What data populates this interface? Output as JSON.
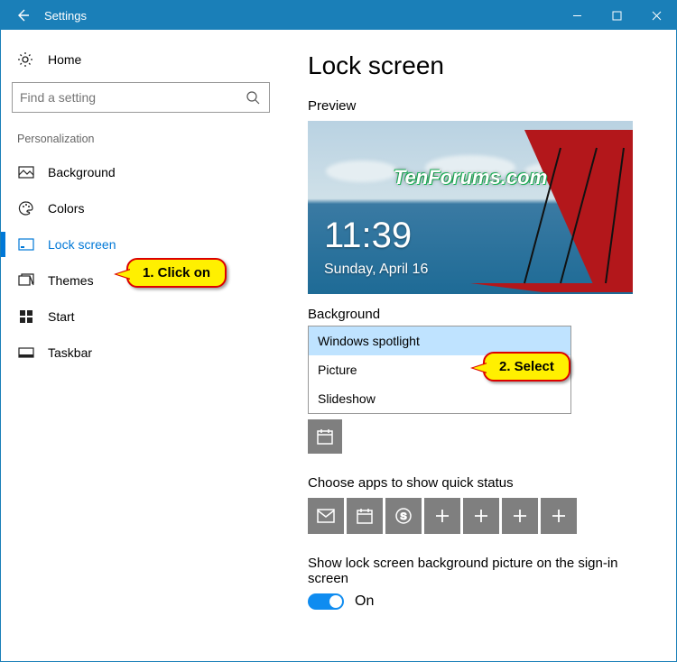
{
  "titlebar": {
    "title": "Settings"
  },
  "sidebar": {
    "home": "Home",
    "search_placeholder": "Find a setting",
    "section": "Personalization",
    "items": [
      {
        "label": "Background"
      },
      {
        "label": "Colors"
      },
      {
        "label": "Lock screen"
      },
      {
        "label": "Themes"
      },
      {
        "label": "Start"
      },
      {
        "label": "Taskbar"
      }
    ]
  },
  "main": {
    "page_title": "Lock screen",
    "preview_label": "Preview",
    "preview_time": "11:39",
    "preview_date": "Sunday, April 16",
    "watermark": "TenForums.com",
    "background_label": "Background",
    "dropdown": {
      "options": [
        "Windows spotlight",
        "Picture",
        "Slideshow"
      ],
      "selected": "Windows spotlight"
    },
    "choose_apps_label": "Choose apps to show quick status",
    "sign_in_label": "Show lock screen background picture on the sign-in screen",
    "toggle_state": "On"
  },
  "callouts": {
    "one": "1. Click on",
    "two": "2. Select"
  }
}
